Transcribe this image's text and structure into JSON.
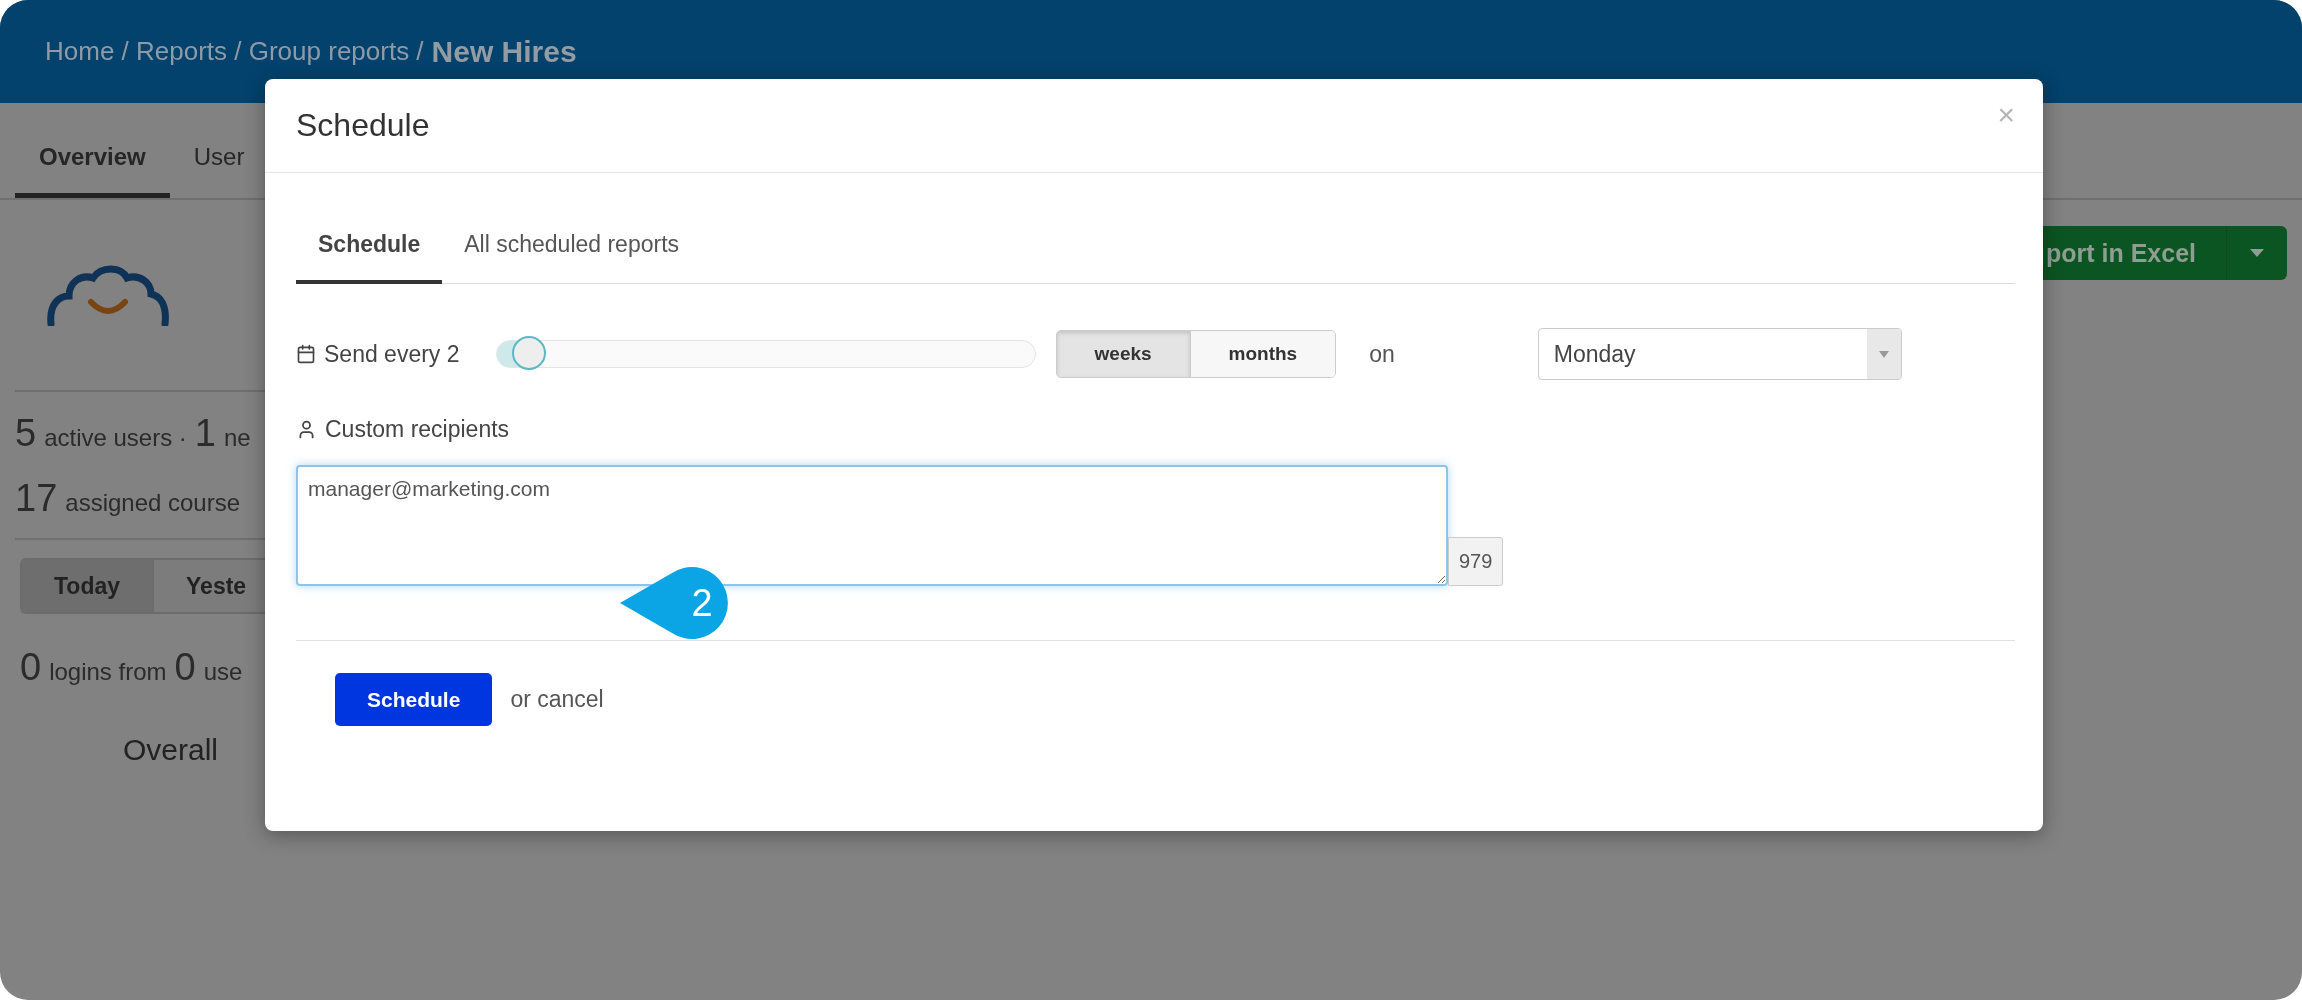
{
  "breadcrumb": {
    "path": "Home / Reports / Group reports /",
    "current": "New Hires"
  },
  "page_tabs": [
    {
      "label": "Overview",
      "selected": true
    },
    {
      "label": "User",
      "selected": false
    }
  ],
  "stats": [
    [
      {
        "num": "5",
        "text": "active users ·"
      },
      {
        "num": "1",
        "text": "ne"
      }
    ],
    [
      {
        "num": "17",
        "text": "assigned course"
      }
    ]
  ],
  "period_tabs": [
    {
      "label": "Today",
      "selected": true
    },
    {
      "label": "Yeste",
      "selected": false
    }
  ],
  "logins": [
    {
      "num": "0",
      "text": "logins from"
    },
    {
      "num": "0",
      "text": "use"
    }
  ],
  "overall": "Overall",
  "export_button": {
    "label": "port in Excel"
  },
  "modal": {
    "title": "Schedule",
    "close": "×",
    "tabs": [
      {
        "label": "Schedule",
        "selected": true
      },
      {
        "label": "All scheduled reports",
        "selected": false
      }
    ],
    "send_every": {
      "label": "Send every 2",
      "level": 0.03
    },
    "units": [
      {
        "label": "weeks",
        "selected": true
      },
      {
        "label": "months",
        "selected": false
      }
    ],
    "on_label": "on",
    "day_select": {
      "value": "Monday"
    },
    "recipients": {
      "label": "Custom recipients",
      "value": "manager@marketing.com",
      "counter": "979"
    },
    "submit": "Schedule",
    "cancel": "or cancel"
  },
  "callout": {
    "number": "2"
  }
}
